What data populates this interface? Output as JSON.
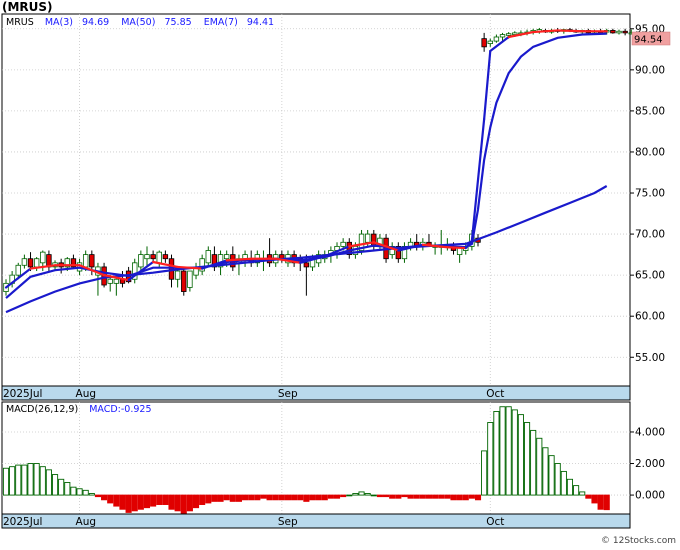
{
  "symbol_label": "(MRUS)",
  "price_legend": [
    {
      "text": "MRUS",
      "color": "#000000"
    },
    {
      "text": "MA(3)",
      "color": "#1a1aff"
    },
    {
      "text": "94.69",
      "color": "#1a1aff"
    },
    {
      "text": "MA(50)",
      "color": "#1a1aff"
    },
    {
      "text": "75.85",
      "color": "#1a1aff"
    },
    {
      "text": "EMA(7)",
      "color": "#1a1aff"
    },
    {
      "text": "94.41",
      "color": "#1a1aff"
    }
  ],
  "last_price_tag": "94.54",
  "macd_legend": {
    "label": "MACD(26,12,9)",
    "value": "MACD:-0.925"
  },
  "watermark": "© 12Stocks.com",
  "colors": {
    "up_candle": "#006400",
    "down_candle": "#e00000",
    "ma_line": "#1a1acc",
    "ema_line": "#ff2020",
    "month_band": "#b9d9ec",
    "grid": "#c8c8c8",
    "tag_bg": "#f0a0a0"
  },
  "chart_data": [
    {
      "type": "candlestick",
      "title": "",
      "y_axis_side": "right",
      "ylim": [
        51.5,
        96.8
      ],
      "y_ticks": [
        55.0,
        60.0,
        65.0,
        70.0,
        75.0,
        80.0,
        85.0,
        90.0,
        95.0
      ],
      "y_tick_labels": [
        "55.00",
        "60.00",
        "65.00",
        "70.00",
        "75.00",
        "80.00",
        "85.00",
        "90.00",
        "95.00"
      ],
      "x_labels": [
        {
          "label": "2025Jul",
          "index": 0
        },
        {
          "label": "Aug",
          "index": 12
        },
        {
          "label": "Sep",
          "index": 45
        },
        {
          "label": "Oct",
          "index": 79
        }
      ],
      "grid": true,
      "candles": [
        [
          63.0,
          64.5,
          62.5,
          64.0
        ],
        [
          64.0,
          65.5,
          63.5,
          65.0
        ],
        [
          65.0,
          66.5,
          64.5,
          66.2
        ],
        [
          66.2,
          67.5,
          65.8,
          67.0
        ],
        [
          67.0,
          67.8,
          65.5,
          66.0
        ],
        [
          66.0,
          67.2,
          65.5,
          67.0
        ],
        [
          66.5,
          68.0,
          65.5,
          67.8
        ],
        [
          67.5,
          68.0,
          65.5,
          66.0
        ],
        [
          66.0,
          66.8,
          65.5,
          66.5
        ],
        [
          66.5,
          67.0,
          65.2,
          66.0
        ],
        [
          66.0,
          67.2,
          65.5,
          67.0
        ],
        [
          67.0,
          67.5,
          65.8,
          66.0
        ],
        [
          65.5,
          67.0,
          65.0,
          66.5
        ],
        [
          66.0,
          68.0,
          65.5,
          67.5
        ],
        [
          67.5,
          68.0,
          65.0,
          66.0
        ],
        [
          65.0,
          66.5,
          62.5,
          66.0
        ],
        [
          66.0,
          66.5,
          63.5,
          63.8
        ],
        [
          64.0,
          65.0,
          63.0,
          64.5
        ],
        [
          64.0,
          65.0,
          62.5,
          64.5
        ],
        [
          64.5,
          65.5,
          63.5,
          64.0
        ],
        [
          65.5,
          66.0,
          64.0,
          64.2
        ],
        [
          64.5,
          67.0,
          64.0,
          66.5
        ],
        [
          66.0,
          68.0,
          65.5,
          67.5
        ],
        [
          67.0,
          68.5,
          66.0,
          67.5
        ],
        [
          67.5,
          68.0,
          66.5,
          67.0
        ],
        [
          66.5,
          68.0,
          66.0,
          67.8
        ],
        [
          67.5,
          68.0,
          66.5,
          67.0
        ],
        [
          67.0,
          67.5,
          63.5,
          64.5
        ],
        [
          64.5,
          66.0,
          63.5,
          65.5
        ],
        [
          65.5,
          66.0,
          62.5,
          63.0
        ],
        [
          63.5,
          65.5,
          63.0,
          65.5
        ],
        [
          65.0,
          66.5,
          64.5,
          66.0
        ],
        [
          65.5,
          67.5,
          65.0,
          67.0
        ],
        [
          66.5,
          68.5,
          66.0,
          68.0
        ],
        [
          67.5,
          68.5,
          65.5,
          66.0
        ],
        [
          66.0,
          68.0,
          65.0,
          67.5
        ],
        [
          67.0,
          68.0,
          66.0,
          67.5
        ],
        [
          67.5,
          68.5,
          65.5,
          66.0
        ],
        [
          66.5,
          67.5,
          65.0,
          67.0
        ],
        [
          67.0,
          68.0,
          66.0,
          67.5
        ],
        [
          67.0,
          68.0,
          66.0,
          66.5
        ],
        [
          66.5,
          68.0,
          66.0,
          67.5
        ],
        [
          67.0,
          68.0,
          65.5,
          67.0
        ],
        [
          67.5,
          69.5,
          66.0,
          66.5
        ],
        [
          66.5,
          68.0,
          66.0,
          67.5
        ],
        [
          67.5,
          68.0,
          66.5,
          67.0
        ],
        [
          66.5,
          68.0,
          66.0,
          67.5
        ],
        [
          67.5,
          68.0,
          66.0,
          66.5
        ],
        [
          67.0,
          67.5,
          65.5,
          66.5
        ],
        [
          66.5,
          67.5,
          62.5,
          66.0
        ],
        [
          66.0,
          67.5,
          65.5,
          67.0
        ],
        [
          66.5,
          68.0,
          66.0,
          67.5
        ],
        [
          67.0,
          68.0,
          66.5,
          67.5
        ],
        [
          67.5,
          68.5,
          66.5,
          68.0
        ],
        [
          68.0,
          69.0,
          67.0,
          68.5
        ],
        [
          68.5,
          69.5,
          68.0,
          69.0
        ],
        [
          69.0,
          69.5,
          67.0,
          67.5
        ],
        [
          67.5,
          69.0,
          67.0,
          68.5
        ],
        [
          68.0,
          70.5,
          67.5,
          70.0
        ],
        [
          69.0,
          70.5,
          68.5,
          70.0
        ],
        [
          70.0,
          70.5,
          68.0,
          68.5
        ],
        [
          68.5,
          70.0,
          68.0,
          69.5
        ],
        [
          69.5,
          70.0,
          66.5,
          67.0
        ],
        [
          67.5,
          69.0,
          67.0,
          68.5
        ],
        [
          68.5,
          69.0,
          66.5,
          67.0
        ],
        [
          67.0,
          69.0,
          66.5,
          68.5
        ],
        [
          68.5,
          69.5,
          68.0,
          69.0
        ],
        [
          69.0,
          70.0,
          68.0,
          68.5
        ],
        [
          68.5,
          69.5,
          68.0,
          69.0
        ],
        [
          69.0,
          70.0,
          68.5,
          68.5
        ],
        [
          68.5,
          69.0,
          67.5,
          68.5
        ],
        [
          68.5,
          70.5,
          67.5,
          68.5
        ],
        [
          68.5,
          69.5,
          68.0,
          68.5
        ],
        [
          68.5,
          69.0,
          67.5,
          68.0
        ],
        [
          67.5,
          68.5,
          66.5,
          68.3
        ],
        [
          68.0,
          69.0,
          67.5,
          68.5
        ],
        [
          68.5,
          70.5,
          68.0,
          70.0
        ],
        [
          69.5,
          70.0,
          68.5,
          69.0
        ],
        [
          93.8,
          94.5,
          92.2,
          92.8
        ],
        [
          93.2,
          93.8,
          92.8,
          93.5
        ],
        [
          93.5,
          94.3,
          93.3,
          94.0
        ],
        [
          94.0,
          94.5,
          93.5,
          94.3
        ],
        [
          94.2,
          94.6,
          93.8,
          94.4
        ],
        [
          94.3,
          94.7,
          94.0,
          94.5
        ],
        [
          94.4,
          94.8,
          94.1,
          94.5
        ],
        [
          94.5,
          94.9,
          94.2,
          94.6
        ],
        [
          94.6,
          95.0,
          94.3,
          94.8
        ],
        [
          94.7,
          95.1,
          94.4,
          94.9
        ],
        [
          94.8,
          95.0,
          94.5,
          94.6
        ],
        [
          94.6,
          95.0,
          94.4,
          94.8
        ],
        [
          94.8,
          95.1,
          94.5,
          94.7
        ],
        [
          94.7,
          95.0,
          94.4,
          94.9
        ],
        [
          94.9,
          95.1,
          94.6,
          94.8
        ],
        [
          94.8,
          95.0,
          94.5,
          94.6
        ],
        [
          94.6,
          94.9,
          94.3,
          94.8
        ],
        [
          94.8,
          95.0,
          94.4,
          94.5
        ],
        [
          94.6,
          94.9,
          94.3,
          94.7
        ],
        [
          94.7,
          95.0,
          94.3,
          94.5
        ],
        [
          94.6,
          95.0,
          94.3,
          94.8
        ],
        [
          94.8,
          95.0,
          94.4,
          94.5
        ],
        [
          94.5,
          94.9,
          94.3,
          94.7
        ],
        [
          94.7,
          95.0,
          94.2,
          94.5
        ],
        [
          94.5,
          94.9,
          94.3,
          94.5
        ]
      ],
      "ma3": [
        [
          0,
          63.5
        ],
        [
          4,
          65.8
        ],
        [
          8,
          66.2
        ],
        [
          12,
          66.2
        ],
        [
          16,
          65.0
        ],
        [
          20,
          64.4
        ],
        [
          24,
          66.6
        ],
        [
          28,
          66.0
        ],
        [
          32,
          65.8
        ],
        [
          36,
          66.8
        ],
        [
          40,
          67.0
        ],
        [
          44,
          67.0
        ],
        [
          48,
          66.5
        ],
        [
          52,
          67.3
        ],
        [
          56,
          68.5
        ],
        [
          60,
          69.0
        ],
        [
          64,
          68.0
        ],
        [
          68,
          68.7
        ],
        [
          72,
          68.4
        ],
        [
          75,
          68.3
        ],
        [
          76,
          69.2
        ],
        [
          78,
          84.0
        ],
        [
          79,
          92.3
        ],
        [
          82,
          94.0
        ],
        [
          86,
          94.6
        ],
        [
          90,
          94.8
        ],
        [
          94,
          94.7
        ],
        [
          98,
          94.69
        ]
      ],
      "ema7": [
        [
          0,
          62.2
        ],
        [
          4,
          64.8
        ],
        [
          8,
          65.6
        ],
        [
          12,
          65.9
        ],
        [
          16,
          65.3
        ],
        [
          20,
          64.9
        ],
        [
          24,
          65.9
        ],
        [
          28,
          65.9
        ],
        [
          32,
          65.9
        ],
        [
          36,
          66.6
        ],
        [
          40,
          66.9
        ],
        [
          44,
          67.0
        ],
        [
          48,
          66.8
        ],
        [
          52,
          67.2
        ],
        [
          56,
          68.0
        ],
        [
          60,
          68.6
        ],
        [
          64,
          68.3
        ],
        [
          68,
          68.6
        ],
        [
          72,
          68.5
        ],
        [
          75,
          68.4
        ],
        [
          76,
          68.8
        ],
        [
          77,
          73.0
        ],
        [
          78,
          79.0
        ],
        [
          79,
          83.0
        ],
        [
          80,
          86.0
        ],
        [
          82,
          89.6
        ],
        [
          84,
          91.6
        ],
        [
          86,
          92.8
        ],
        [
          90,
          93.9
        ],
        [
          94,
          94.3
        ],
        [
          98,
          94.41
        ]
      ],
      "ma50": [
        [
          0,
          60.5
        ],
        [
          4,
          61.8
        ],
        [
          8,
          63.0
        ],
        [
          12,
          64.0
        ],
        [
          16,
          64.7
        ],
        [
          20,
          65.0
        ],
        [
          24,
          65.3
        ],
        [
          28,
          65.7
        ],
        [
          32,
          66.0
        ],
        [
          36,
          66.3
        ],
        [
          40,
          66.6
        ],
        [
          44,
          66.9
        ],
        [
          48,
          67.1
        ],
        [
          52,
          67.4
        ],
        [
          56,
          67.7
        ],
        [
          60,
          68.0
        ],
        [
          64,
          68.3
        ],
        [
          68,
          68.5
        ],
        [
          72,
          68.7
        ],
        [
          75,
          68.8
        ],
        [
          76,
          69.1
        ],
        [
          80,
          70.2
        ],
        [
          84,
          71.4
        ],
        [
          88,
          72.6
        ],
        [
          92,
          73.8
        ],
        [
          96,
          75.0
        ],
        [
          98,
          75.85
        ]
      ]
    },
    {
      "type": "bar",
      "title": "",
      "y_axis_side": "right",
      "ylim": [
        -1.2,
        5.9
      ],
      "y_ticks": [
        0.0,
        2.0,
        4.0
      ],
      "y_tick_labels": [
        "0.000",
        "2.000",
        "4.000"
      ],
      "x_labels": [
        {
          "label": "2025Jul",
          "index": 0
        },
        {
          "label": "Aug",
          "index": 12
        },
        {
          "label": "Sep",
          "index": 45
        },
        {
          "label": "Oct",
          "index": 79
        }
      ],
      "grid": true,
      "values": [
        1.7,
        1.8,
        1.9,
        1.9,
        2.0,
        2.0,
        1.8,
        1.6,
        1.3,
        1.0,
        0.8,
        0.5,
        0.4,
        0.3,
        0.1,
        -0.1,
        -0.3,
        -0.5,
        -0.7,
        -0.9,
        -1.1,
        -1.0,
        -0.9,
        -0.8,
        -0.7,
        -0.6,
        -0.6,
        -0.9,
        -1.0,
        -1.2,
        -1.0,
        -0.8,
        -0.6,
        -0.5,
        -0.4,
        -0.4,
        -0.3,
        -0.4,
        -0.4,
        -0.3,
        -0.3,
        -0.3,
        -0.2,
        -0.3,
        -0.3,
        -0.3,
        -0.3,
        -0.3,
        -0.3,
        -0.4,
        -0.3,
        -0.3,
        -0.3,
        -0.2,
        -0.2,
        -0.1,
        0.0,
        0.1,
        0.2,
        0.1,
        0.0,
        -0.1,
        -0.1,
        -0.2,
        -0.2,
        -0.1,
        -0.2,
        -0.2,
        -0.2,
        -0.2,
        -0.2,
        -0.2,
        -0.2,
        -0.3,
        -0.3,
        -0.3,
        -0.2,
        -0.3,
        2.8,
        4.6,
        5.3,
        5.6,
        5.6,
        5.4,
        5.1,
        4.6,
        4.1,
        3.6,
        3.0,
        2.5,
        2.0,
        1.5,
        1.0,
        0.6,
        0.2,
        -0.2,
        -0.5,
        -0.9,
        -0.925
      ]
    }
  ]
}
